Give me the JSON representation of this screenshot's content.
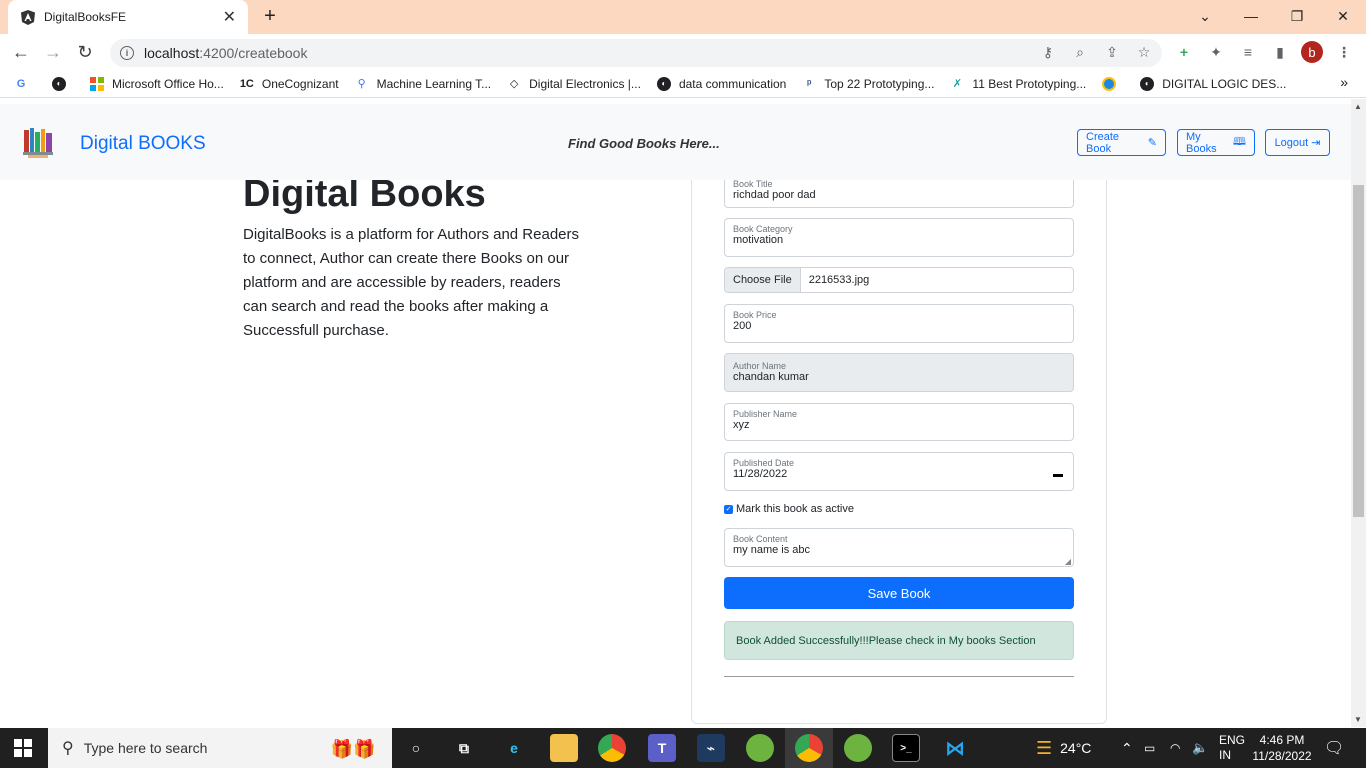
{
  "browser": {
    "tab_title": "DigitalBooksFE",
    "tab_close": "✕",
    "new_tab": "+",
    "address_host": "localhost",
    "address_path": ":4200/createbook",
    "profile_initial": "b",
    "bookmarks": [
      {
        "label": "Microsoft Office Ho...",
        "icon": "microsoft-icon"
      },
      {
        "label": "OneCognizant",
        "icon": "onecognizant-icon"
      },
      {
        "label": "Machine Learning T...",
        "icon": "ml-icon"
      },
      {
        "label": "Digital Electronics |...",
        "icon": "digital-electronics-icon"
      },
      {
        "label": "data communication",
        "icon": "globe-icon"
      },
      {
        "label": "Top 22 Prototyping...",
        "icon": "prototyping-icon"
      },
      {
        "label": "11 Best Prototyping...",
        "icon": "prototyping2-icon"
      },
      {
        "label": "",
        "icon": "circle-logo-icon"
      },
      {
        "label": "DIGITAL LOGIC DES...",
        "icon": "globe-icon"
      }
    ],
    "bookmarks_more": "»"
  },
  "app": {
    "brand": "Digital BOOKS",
    "tagline": "Find Good Books Here...",
    "nav": {
      "create_book": "Create Book",
      "my_books": "My Books",
      "logout": "Logout"
    }
  },
  "hero": {
    "title": "Digital Books",
    "text": "DigitalBooks is a platform for Authors and Readers to connect, Author can create there Books on our platform and are accessible by readers, readers can search and read the books after making a Successfull purchase."
  },
  "form": {
    "title": {
      "label": "Book Title",
      "value": "richdad poor dad"
    },
    "category": {
      "label": "Book Category",
      "value": "motivation"
    },
    "file": {
      "button": "Choose File",
      "name": "2216533.jpg"
    },
    "price": {
      "label": "Book Price",
      "value": "200"
    },
    "author": {
      "label": "Author Name",
      "value": "chandan kumar"
    },
    "publisher": {
      "label": "Publisher Name",
      "value": "xyz"
    },
    "published_date": {
      "label": "Published Date",
      "value": "11/28/2022"
    },
    "active_label": "Mark this book as active",
    "active_checked": true,
    "content": {
      "label": "Book Content",
      "value": "my name is abc"
    },
    "save_label": "Save Book",
    "alert": "Book Added Successfully!!!Please check in My books Section"
  },
  "taskbar": {
    "search_placeholder": "Type here to search",
    "weather": "24°C",
    "lang_top": "ENG",
    "lang_bottom": "IN",
    "time": "4:46 PM",
    "date": "11/28/2022"
  },
  "colors": {
    "primary": "#0d6efd",
    "success_bg": "#d1e7dd",
    "success_text": "#0f5132",
    "tabstrip": "#fcd8c0",
    "taskbar": "#202020"
  }
}
